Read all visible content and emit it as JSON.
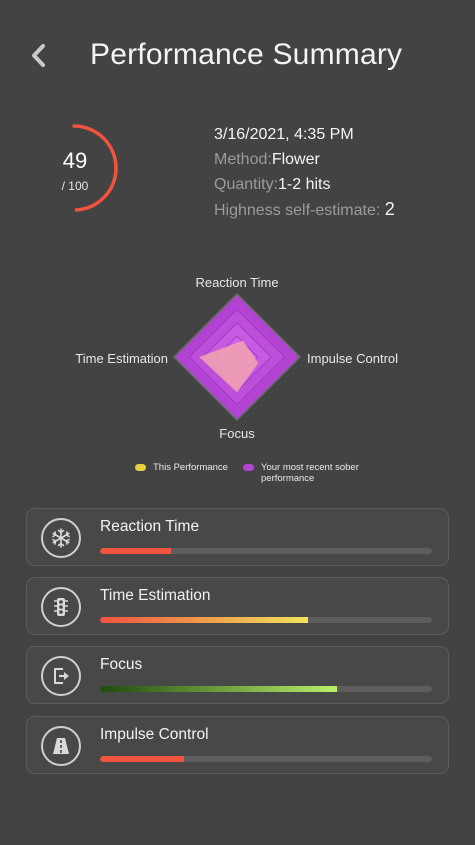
{
  "header": {
    "title": "Performance Summary"
  },
  "score": {
    "value": "49",
    "max": "/ 100",
    "fraction": 0.49,
    "ring_color": "#f0533e"
  },
  "session": {
    "datetime": "3/16/2021, 4:35 PM",
    "method_label": "Method:",
    "method_value": "Flower",
    "quantity_label": "Quantity:",
    "quantity_value": "1-2 hits",
    "highness_label": "Highness self-estimate:",
    "highness_value": "2"
  },
  "radar": {
    "axes": {
      "top": "Reaction Time",
      "right": "Impulse Control",
      "bottom": "Focus",
      "left": "Time Estimation"
    },
    "this_performance": {
      "reaction_time": 0.22,
      "impulse_control": 0.35,
      "focus": 0.58,
      "time_estimation": 0.62,
      "color": "#f0a0b4"
    },
    "sober_performance": {
      "reaction_time": 1.0,
      "impulse_control": 1.0,
      "focus": 1.0,
      "time_estimation": 1.0,
      "color": "#b344d3"
    }
  },
  "legend": {
    "this_label": "This Performance",
    "this_color": "#e6d23c",
    "sober_label": "Your most recent sober performance",
    "sober_color": "#b344d3"
  },
  "metrics": [
    {
      "name": "Reaction Time",
      "icon": "snowflake-icon",
      "fraction": 0.215,
      "gradient": [
        "#f0533e",
        "#f0533e"
      ]
    },
    {
      "name": "Time Estimation",
      "icon": "traffic-light-icon",
      "fraction": 0.627,
      "gradient": [
        "#f0533e",
        "#f0e45a"
      ]
    },
    {
      "name": "Focus",
      "icon": "exit-door-icon",
      "fraction": 0.715,
      "gradient": [
        "#1f4a0f",
        "#b8f06a"
      ]
    },
    {
      "name": "Impulse Control",
      "icon": "road-icon",
      "fraction": 0.253,
      "gradient": [
        "#f0533e",
        "#f0533e"
      ]
    }
  ]
}
